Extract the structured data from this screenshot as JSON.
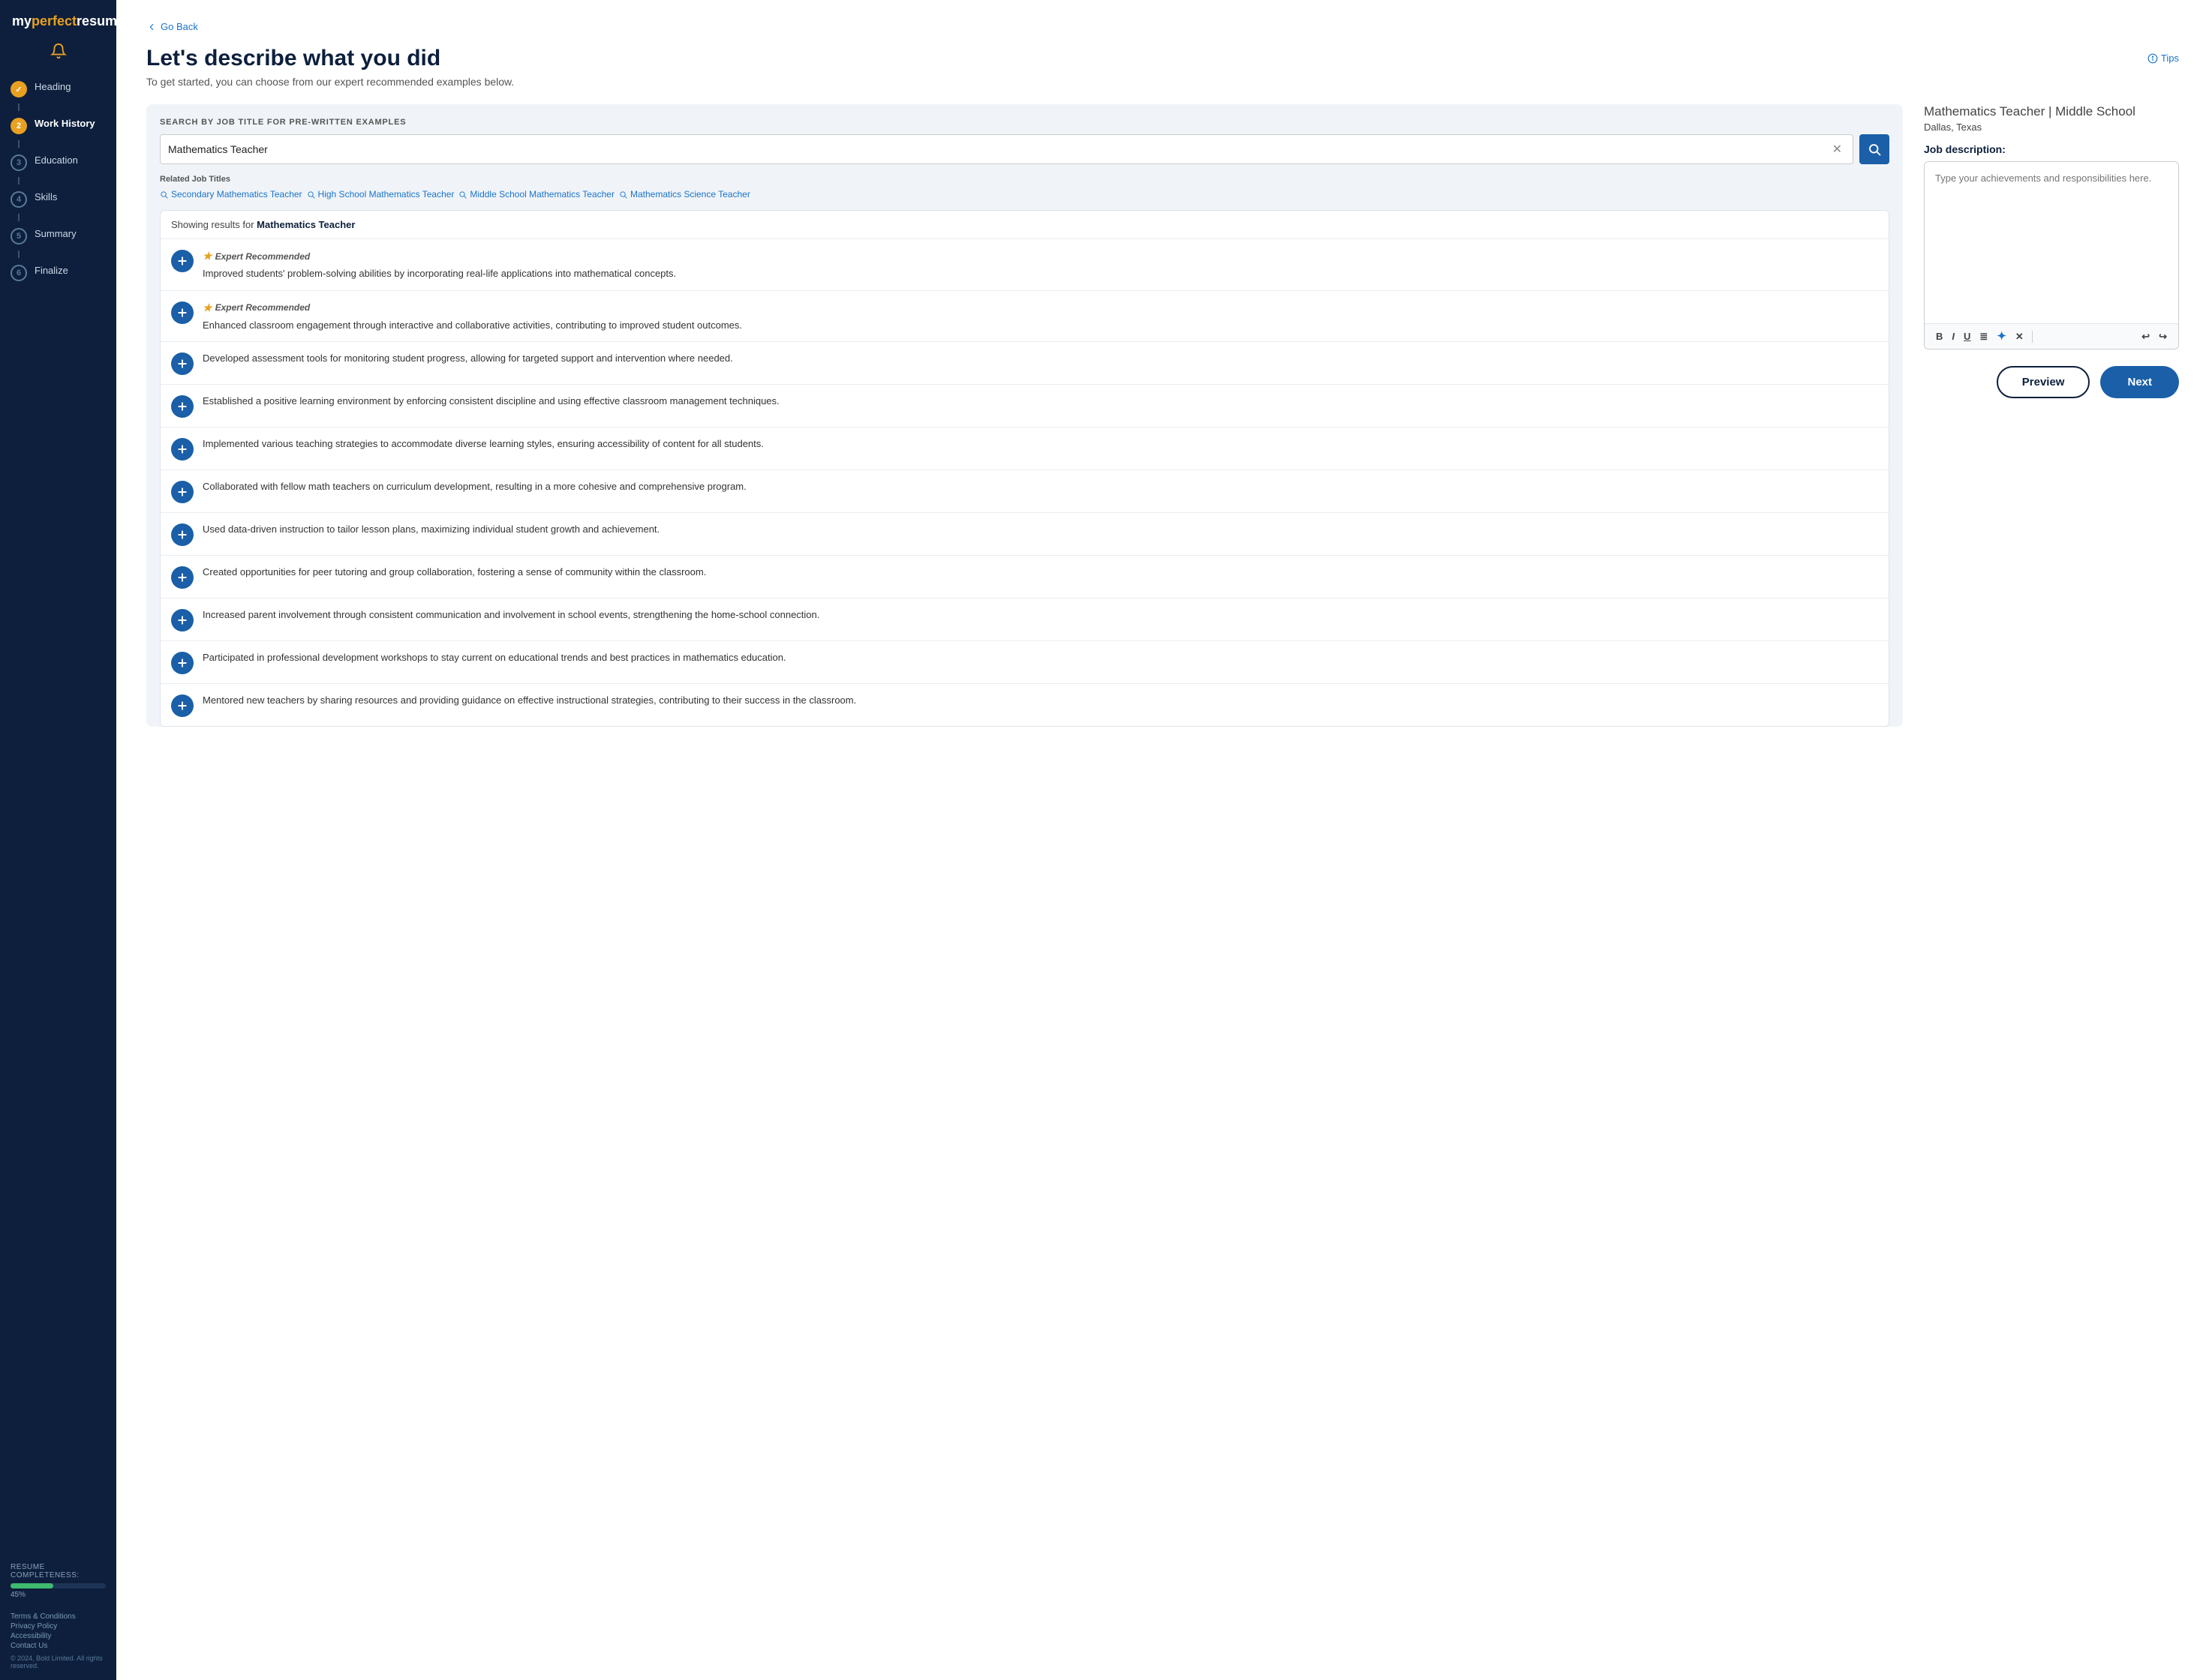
{
  "sidebar": {
    "logo": {
      "my": "my",
      "perfect": "perfect",
      "resume": "resume"
    },
    "nav_items": [
      {
        "step": 1,
        "label": "Heading",
        "state": "done"
      },
      {
        "step": 2,
        "label": "Work History",
        "state": "active"
      },
      {
        "step": 3,
        "label": "Education",
        "state": "inactive"
      },
      {
        "step": 4,
        "label": "Skills",
        "state": "inactive"
      },
      {
        "step": 5,
        "label": "Summary",
        "state": "inactive"
      },
      {
        "step": 6,
        "label": "Finalize",
        "state": "inactive"
      }
    ],
    "completeness_label": "RESUME COMPLETENESS:",
    "completeness_pct": 45,
    "completeness_pct_label": "45%",
    "footer_links": [
      "Terms & Conditions",
      "Privacy Policy",
      "Accessibility",
      "Contact Us"
    ],
    "copyright": "© 2024, Bold Limited. All rights reserved."
  },
  "header": {
    "go_back": "Go Back",
    "title": "Let's describe what you did",
    "subtitle": "To get started, you can choose from our expert recommended examples below.",
    "tips": "Tips"
  },
  "search": {
    "panel_label": "SEARCH BY JOB TITLE FOR PRE-WRITTEN EXAMPLES",
    "input_value": "Mathematics Teacher",
    "related_label": "Related Job Titles",
    "related_tags": [
      "Secondary Mathematics Teacher",
      "High School Mathematics Teacher",
      "Middle School Mathematics Teacher",
      "Mathematics Science Teacher"
    ],
    "results_showing": "Showing results for ",
    "results_keyword": "Mathematics Teacher",
    "results": [
      {
        "id": 1,
        "expert": true,
        "text": "Improved students' problem-solving abilities by incorporating real-life applications into mathematical concepts."
      },
      {
        "id": 2,
        "expert": true,
        "text": "Enhanced classroom engagement through interactive and collaborative activities, contributing to improved student outcomes."
      },
      {
        "id": 3,
        "expert": false,
        "text": "Developed assessment tools for monitoring student progress, allowing for targeted support and intervention where needed."
      },
      {
        "id": 4,
        "expert": false,
        "text": "Established a positive learning environment by enforcing consistent discipline and using effective classroom management techniques."
      },
      {
        "id": 5,
        "expert": false,
        "text": "Implemented various teaching strategies to accommodate diverse learning styles, ensuring accessibility of content for all students."
      },
      {
        "id": 6,
        "expert": false,
        "text": "Collaborated with fellow math teachers on curriculum development, resulting in a more cohesive and comprehensive program."
      },
      {
        "id": 7,
        "expert": false,
        "text": "Used data-driven instruction to tailor lesson plans, maximizing individual student growth and achievement."
      },
      {
        "id": 8,
        "expert": false,
        "text": "Created opportunities for peer tutoring and group collaboration, fostering a sense of community within the classroom."
      },
      {
        "id": 9,
        "expert": false,
        "text": "Increased parent involvement through consistent communication and involvement in school events, strengthening the home-school connection."
      },
      {
        "id": 10,
        "expert": false,
        "text": "Participated in professional development workshops to stay current on educational trends and best practices in mathematics education."
      },
      {
        "id": 11,
        "expert": false,
        "text": "Mentored new teachers by sharing resources and providing guidance on effective instructional strategies, contributing to their success in the classroom."
      }
    ]
  },
  "job": {
    "title": "Mathematics Teacher",
    "separator": "| Middle School",
    "location": "Dallas, Texas",
    "desc_label": "Job description:",
    "textarea_placeholder": "Type your achievements and responsibilities here."
  },
  "toolbar": {
    "bold": "B",
    "italic": "I",
    "underline": "U",
    "list": "≡",
    "ai": "✦",
    "clear": "✕",
    "undo": "↩",
    "redo": "↪",
    "expert_badge_label": "Expert Recommended"
  },
  "actions": {
    "preview_label": "Preview",
    "next_label": "Next"
  }
}
